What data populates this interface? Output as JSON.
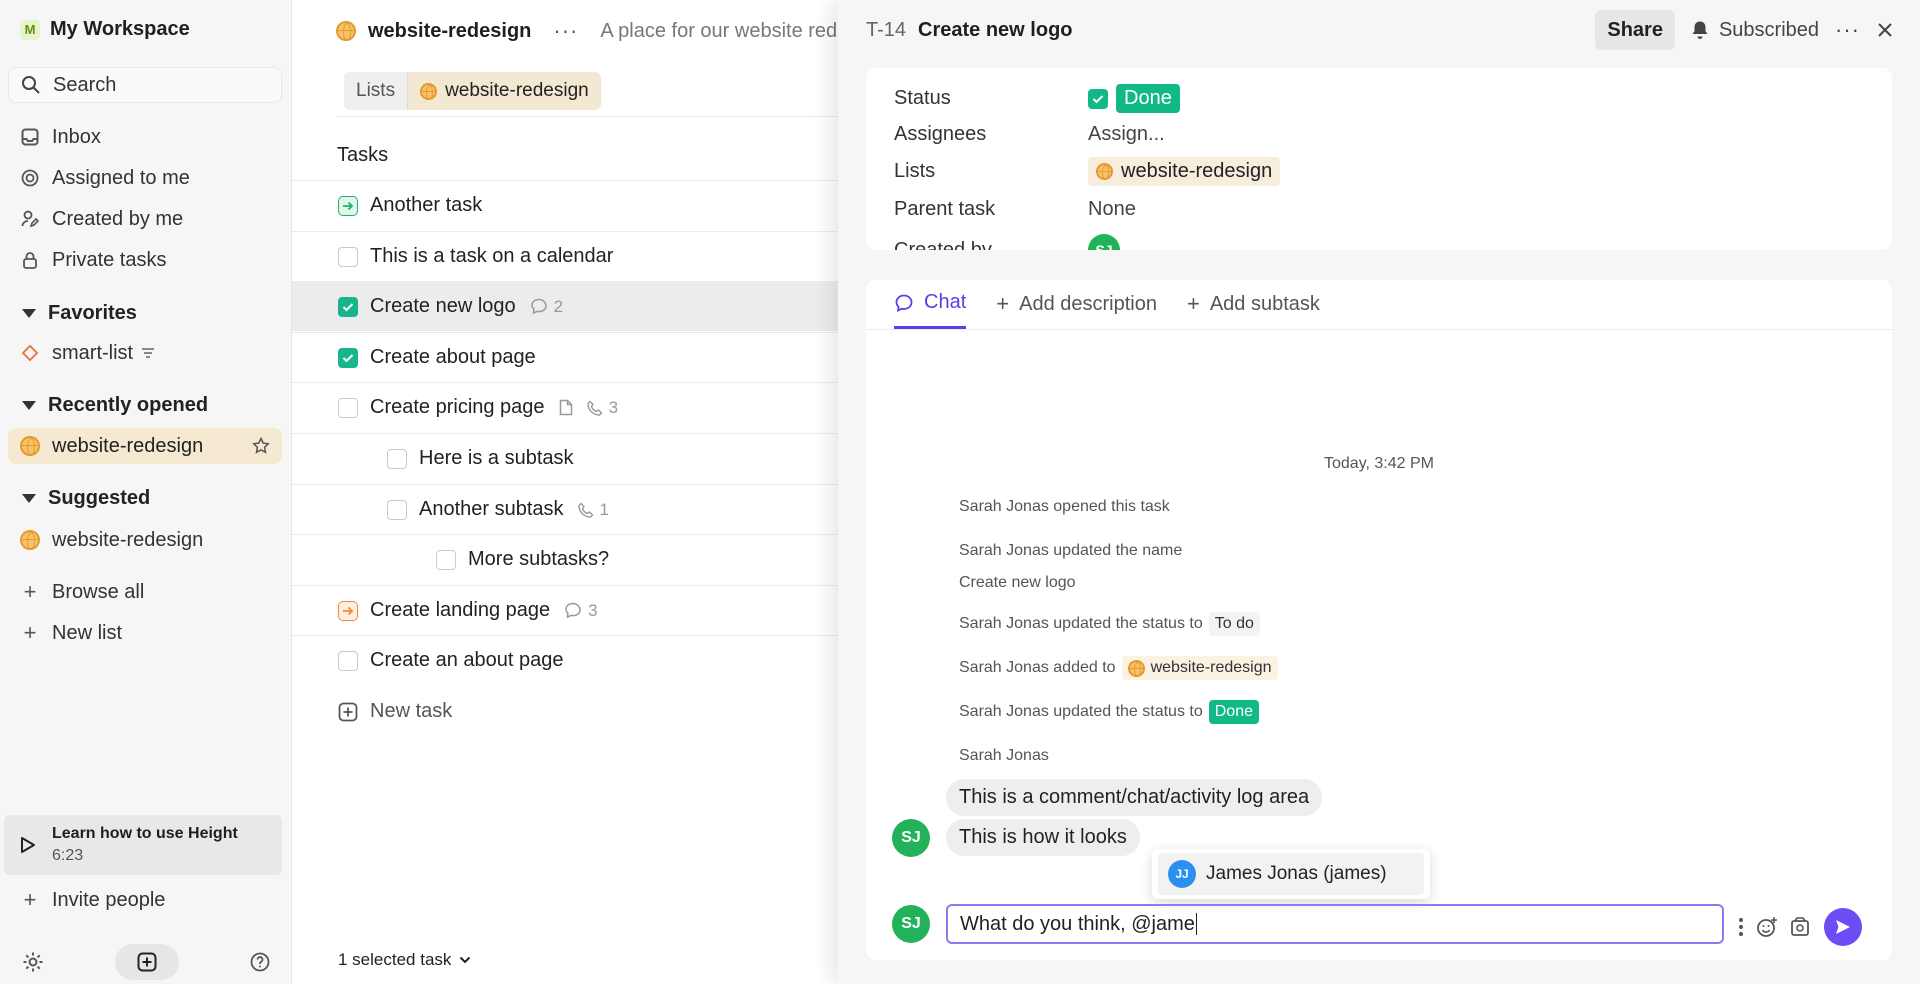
{
  "sidebar": {
    "workspace_badge": "M",
    "workspace_name": "My Workspace",
    "search_label": "Search",
    "nav": [
      {
        "label": "Inbox",
        "icon": "inbox-icon"
      },
      {
        "label": "Assigned to me",
        "icon": "target-icon"
      },
      {
        "label": "Created by me",
        "icon": "user-edit-icon"
      },
      {
        "label": "Private tasks",
        "icon": "lock-icon"
      }
    ],
    "favorites_title": "Favorites",
    "favorites_item": "smart-list",
    "recent_title": "Recently opened",
    "recent_item": "website-redesign",
    "suggested_title": "Suggested",
    "suggested_item": "website-redesign",
    "browse_all": "Browse all",
    "new_list": "New list",
    "learn_title": "Learn how to use Height",
    "learn_duration": "6:23",
    "invite": "Invite people"
  },
  "center": {
    "list_title": "website-redesign",
    "list_desc": "A place for our website redes",
    "breadcrumb_lists": "Lists",
    "breadcrumb_current": "website-redesign",
    "tasks_header": "Tasks",
    "tasks": [
      {
        "label": "Another task",
        "state": "in-progress",
        "comments": null,
        "calls": null,
        "doc": false,
        "indent": 0,
        "selected": false
      },
      {
        "label": "This is a task on a calendar",
        "state": "todo",
        "comments": null,
        "calls": null,
        "doc": false,
        "indent": 0,
        "selected": false
      },
      {
        "label": "Create new logo",
        "state": "done",
        "comments": "2",
        "calls": null,
        "doc": false,
        "indent": 0,
        "selected": true
      },
      {
        "label": "Create about page",
        "state": "done",
        "comments": null,
        "calls": null,
        "doc": false,
        "indent": 0,
        "selected": false
      },
      {
        "label": "Create pricing page",
        "state": "todo",
        "comments": null,
        "calls": "3",
        "doc": true,
        "indent": 0,
        "selected": false
      },
      {
        "label": "Here is a subtask",
        "state": "todo",
        "comments": null,
        "calls": null,
        "doc": false,
        "indent": 1,
        "selected": false
      },
      {
        "label": "Another subtask",
        "state": "todo",
        "comments": null,
        "calls": "1",
        "doc": false,
        "indent": 1,
        "selected": false
      },
      {
        "label": "More subtasks?",
        "state": "todo",
        "comments": null,
        "calls": null,
        "doc": false,
        "indent": 2,
        "selected": false
      },
      {
        "label": "Create landing page",
        "state": "in-review",
        "comments": "3",
        "calls": null,
        "doc": false,
        "indent": 0,
        "selected": false
      },
      {
        "label": "Create an about page",
        "state": "todo",
        "comments": null,
        "calls": null,
        "doc": false,
        "indent": 0,
        "selected": false
      }
    ],
    "new_task": "New task",
    "selected_count": "1 selected task"
  },
  "detail": {
    "task_id": "T-14",
    "task_name": "Create new logo",
    "share": "Share",
    "subscribed": "Subscribed",
    "props": {
      "status_key": "Status",
      "status_value": "Done",
      "assignees_key": "Assignees",
      "assignees_value": "Assign...",
      "lists_key": "Lists",
      "lists_value": "website-redesign",
      "parent_key": "Parent task",
      "parent_value": "None",
      "created_key": "Created by",
      "created_initials": "SJ"
    },
    "tabs": {
      "chat": "Chat",
      "add_description": "Add description",
      "add_subtask": "Add subtask"
    },
    "timestamp": "Today, 3:42 PM",
    "activity": {
      "opened": "Sarah Jonas opened this task",
      "renamed": "Sarah Jonas updated the name",
      "new_name": "Create new logo",
      "status_todo_prefix": "Sarah Jonas updated the status to",
      "status_todo": "To do",
      "added_prefix": "Sarah Jonas added to",
      "added_list": "website-redesign",
      "status_done_prefix": "Sarah Jonas updated the status to",
      "status_done": "Done"
    },
    "comment_author": "Sarah Jonas",
    "comment_author_initials": "SJ",
    "comments": [
      "This is a comment/chat/activity log area",
      "This is how it looks"
    ],
    "mention_initials": "JJ",
    "mention_suggestion": "James Jonas (james)",
    "composer_avatar": "SJ",
    "composer_text": "What do you think, @jame"
  },
  "colors": {
    "accent": "#5a3ee8",
    "done_green": "#12b886",
    "avatar_green": "#22b25a"
  }
}
